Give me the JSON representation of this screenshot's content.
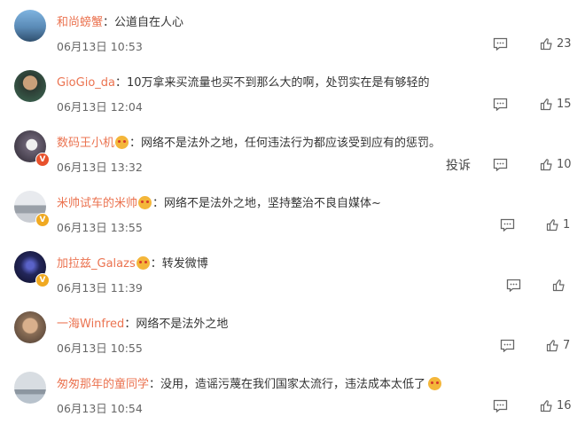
{
  "comments": [
    {
      "username": "和尚螃蟹",
      "emoji": false,
      "text": "公道自在人心",
      "time": "06月13日 10:53",
      "report": "",
      "likes": "23",
      "avatar_color": "#5a8ab6"
    },
    {
      "username": "GioGio_da",
      "emoji": false,
      "text": "10万拿来买流量也买不到那么大的啊，处罚实在是有够轻的",
      "time": "06月13日 12:04",
      "report": "",
      "likes": "15",
      "avatar_color": "#3d6b55"
    },
    {
      "username": "数码王小机",
      "emoji": true,
      "text": "网络不是法外之地，任何违法行为都应该受到应有的惩罚。",
      "time": "06月13日 13:32",
      "report": "投诉",
      "likes": "10",
      "avatar_color": "#6a6172"
    },
    {
      "username": "米帅试车的米帅",
      "emoji": true,
      "text": "网络不是法外之地，坚持整治不良自媒体~",
      "time": "06月13日 13:55",
      "report": "",
      "likes": "1",
      "avatar_color": "#c9ccd2"
    },
    {
      "username": "加拉兹_Galazs",
      "emoji": true,
      "text": "转发微博",
      "time": "06月13日 11:39",
      "report": "",
      "likes": "",
      "avatar_color": "#23265a"
    },
    {
      "username": "一海Winfred",
      "emoji": false,
      "text": "网络不是法外之地",
      "time": "06月13日 10:55",
      "report": "",
      "likes": "7",
      "avatar_color": "#8a6e56"
    },
    {
      "username": "匆匆那年的童同学",
      "emoji": false,
      "text": "没用，造谣污蔑在我们国家太流行，违法成本太低了",
      "time": "06月13日 10:54",
      "report": "",
      "likes": "16",
      "avatar_color": "#b8c2cc"
    }
  ],
  "badge_colors": {
    "red": "#e8512c",
    "gold": "#f0a921"
  },
  "icons": {
    "reply": "comment-icon",
    "like": "thumbs-up-icon",
    "laugh": "laugh-emoji-icon"
  }
}
